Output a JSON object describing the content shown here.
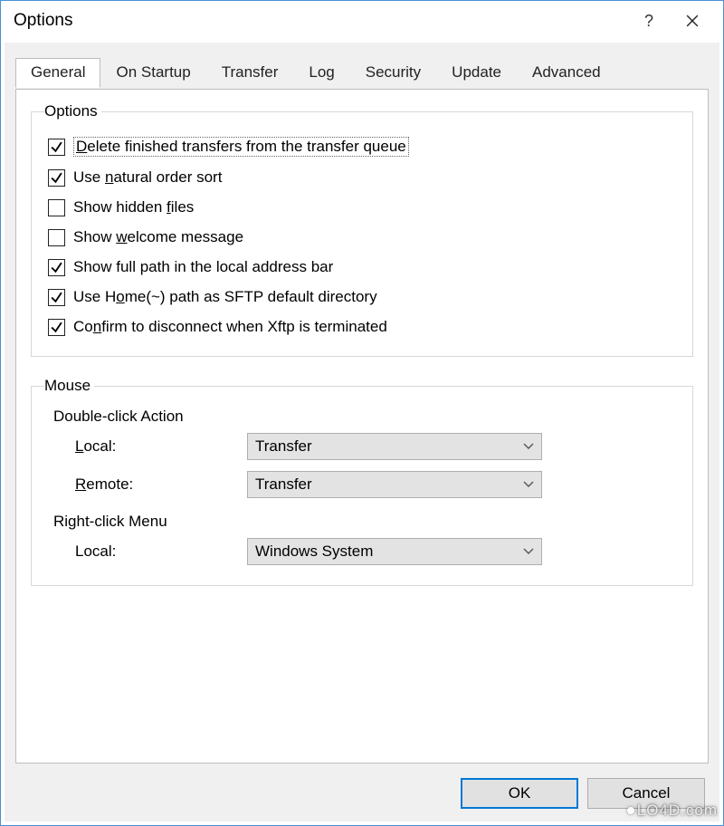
{
  "window": {
    "title": "Options"
  },
  "tabs": [
    {
      "label": "General",
      "active": true
    },
    {
      "label": "On Startup",
      "active": false
    },
    {
      "label": "Transfer",
      "active": false
    },
    {
      "label": "Log",
      "active": false
    },
    {
      "label": "Security",
      "active": false
    },
    {
      "label": "Update",
      "active": false
    },
    {
      "label": "Advanced",
      "active": false
    }
  ],
  "options_group": {
    "legend": "Options",
    "items": [
      {
        "checked": true,
        "pre": "",
        "u": "D",
        "post": "elete finished transfers from the transfer queue",
        "focused": true
      },
      {
        "checked": true,
        "pre": "Use ",
        "u": "n",
        "post": "atural order sort"
      },
      {
        "checked": false,
        "pre": "Show hidden ",
        "u": "f",
        "post": "iles"
      },
      {
        "checked": false,
        "pre": "Show ",
        "u": "w",
        "post": "elcome message"
      },
      {
        "checked": true,
        "pre": "Show full path in the local address bar",
        "u": "",
        "post": ""
      },
      {
        "checked": true,
        "pre": "Use H",
        "u": "o",
        "post": "me(~) path as SFTP default directory"
      },
      {
        "checked": true,
        "pre": "Co",
        "u": "n",
        "post": "firm to disconnect when Xftp is terminated"
      }
    ]
  },
  "mouse_group": {
    "legend": "Mouse",
    "dbl_heading": "Double-click Action",
    "local": {
      "pre": "",
      "u": "L",
      "post": "ocal:",
      "value": "Transfer"
    },
    "remote": {
      "pre": "",
      "u": "R",
      "post": "emote:",
      "value": "Transfer"
    },
    "rc_heading": "Right-click Menu",
    "rc_local": {
      "label": "Local:",
      "value": "Windows System"
    }
  },
  "buttons": {
    "ok": "OK",
    "cancel": "Cancel"
  },
  "watermark": "LO4D.com"
}
